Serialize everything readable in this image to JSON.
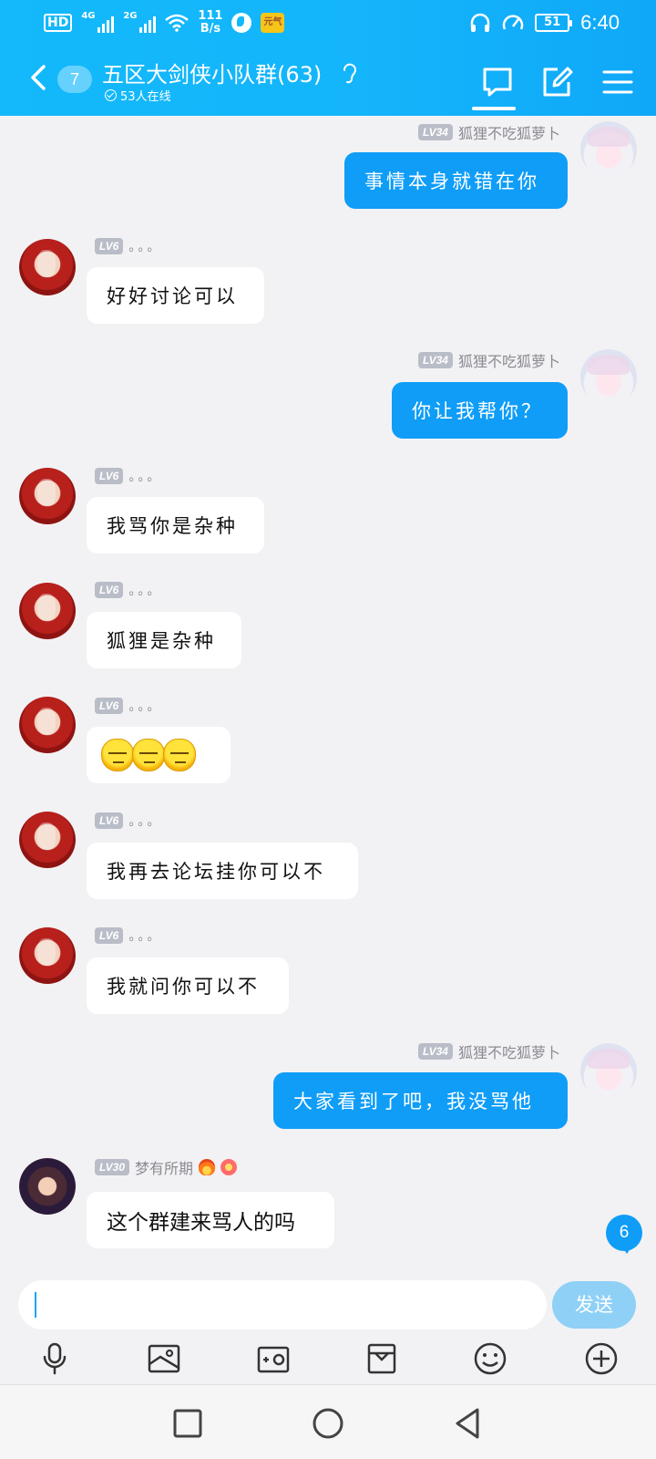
{
  "status_bar": {
    "hd": "HD",
    "net1": "4G",
    "net2": "2G",
    "speed_value": "111",
    "speed_unit": "B/s",
    "app_badge": "元气",
    "battery": "51",
    "time": "6:40"
  },
  "header": {
    "unread_count": "7",
    "title": "五区大剑侠小队群(63)",
    "online": "53人在线",
    "colors": {
      "header_bg": "#13b9fa",
      "bubble_self": "#0f9df7",
      "send_btn": "#8fd0f6"
    }
  },
  "messages": [
    {
      "side": "right",
      "level": "LV34",
      "name": "狐狸不吃狐萝卜",
      "text": "事情本身就错在你"
    },
    {
      "side": "left",
      "level": "LV6",
      "name": "。。。",
      "text": "好好讨论可以"
    },
    {
      "side": "right",
      "level": "LV34",
      "name": "狐狸不吃狐萝卜",
      "text": "你让我帮你？"
    },
    {
      "side": "left",
      "level": "LV6",
      "name": "。。。",
      "text": "我骂你是杂种"
    },
    {
      "side": "left",
      "level": "LV6",
      "name": "。。。",
      "text": "狐狸是杂种"
    },
    {
      "side": "left",
      "level": "LV6",
      "name": "。。。",
      "emoji": "sweat-face-emoji x3"
    },
    {
      "side": "left",
      "level": "LV6",
      "name": "。。。",
      "text": "我再去论坛挂你可以不"
    },
    {
      "side": "left",
      "level": "LV6",
      "name": "。。。",
      "text": "我就问你可以不"
    },
    {
      "side": "right",
      "level": "LV34",
      "name": "狐狸不吃狐萝卜",
      "text": "大家看到了吧，我没骂他"
    },
    {
      "side": "left",
      "level": "LV30",
      "name": "梦有所期",
      "text": "这个群建来骂人的吗"
    }
  ],
  "new_message_badge": "6",
  "input": {
    "value": "",
    "send_label": "发送"
  },
  "toolbar_icons": [
    "mic-icon",
    "image-icon",
    "camera-icon",
    "gift-icon",
    "emoji-icon",
    "plus-icon"
  ],
  "nav_icons": [
    "recent-apps-icon",
    "home-icon",
    "back-icon"
  ]
}
